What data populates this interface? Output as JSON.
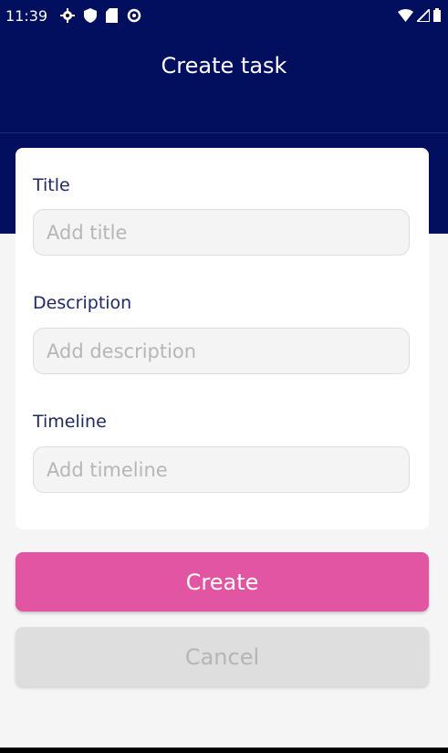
{
  "status_bar": {
    "time": "11:39",
    "left_icons": [
      "gear-icon",
      "shield-icon",
      "sd-card-icon",
      "data-saver-icon"
    ],
    "right_icons": [
      "wifi-icon",
      "signal-icon",
      "battery-icon"
    ]
  },
  "header": {
    "title": "Create task"
  },
  "form": {
    "title_label": "Title",
    "title_placeholder": "Add title",
    "description_label": "Description",
    "description_placeholder": "Add description",
    "timeline_label": "Timeline",
    "timeline_placeholder": "Add timeline"
  },
  "actions": {
    "create_label": "Create",
    "cancel_label": "Cancel"
  },
  "colors": {
    "header_bg": "#020f5e",
    "create_button": "#e255a3",
    "cancel_button": "#dedede",
    "label_text": "#1f2a63"
  }
}
